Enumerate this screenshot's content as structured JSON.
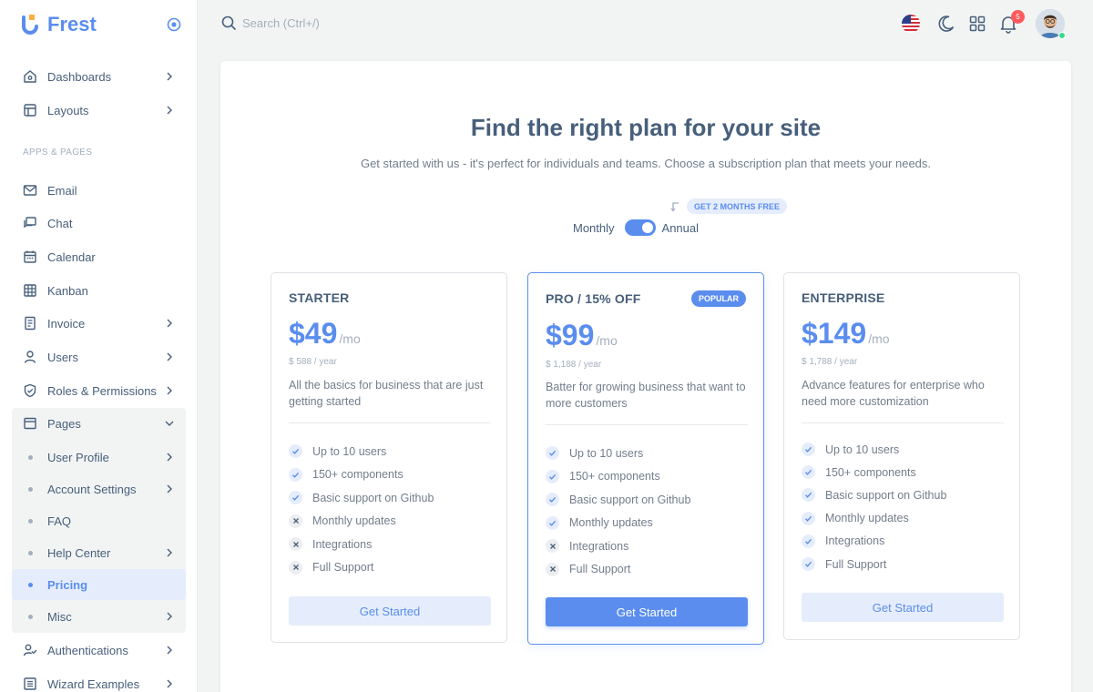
{
  "brand": {
    "name": "Frest",
    "color": "#5a8dee"
  },
  "sidebar": {
    "items_top": [
      {
        "label": "Dashboards",
        "icon": "home-icon",
        "has_children": true
      },
      {
        "label": "Layouts",
        "icon": "layout-icon",
        "has_children": true
      }
    ],
    "section_header": "APPS & PAGES",
    "items_apps": [
      {
        "label": "Email",
        "icon": "mail-icon",
        "has_children": false
      },
      {
        "label": "Chat",
        "icon": "chat-icon",
        "has_children": false
      },
      {
        "label": "Calendar",
        "icon": "calendar-icon",
        "has_children": false
      },
      {
        "label": "Kanban",
        "icon": "kanban-icon",
        "has_children": false
      },
      {
        "label": "Invoice",
        "icon": "invoice-icon",
        "has_children": true
      },
      {
        "label": "Users",
        "icon": "user-icon",
        "has_children": true
      },
      {
        "label": "Roles & Permissions",
        "icon": "shield-icon",
        "has_children": true
      },
      {
        "label": "Pages",
        "icon": "page-icon",
        "expanded": true
      }
    ],
    "pages_sub": [
      {
        "label": "User Profile",
        "has_children": true
      },
      {
        "label": "Account Settings",
        "has_children": true
      },
      {
        "label": "FAQ",
        "has_children": false
      },
      {
        "label": "Help Center",
        "has_children": true
      },
      {
        "label": "Pricing",
        "has_children": false,
        "active": true
      },
      {
        "label": "Misc",
        "has_children": true
      }
    ],
    "items_bottom": [
      {
        "label": "Authentications",
        "icon": "auth-icon",
        "has_children": true
      },
      {
        "label": "Wizard Examples",
        "icon": "wizard-icon",
        "has_children": true
      }
    ]
  },
  "topbar": {
    "search_placeholder": "Search (Ctrl+/)",
    "notification_count": "5"
  },
  "pricing": {
    "title": "Find the right plan for your site",
    "subtitle": "Get started with us - it's perfect for individuals and teams. Choose a subscription plan that meets your needs.",
    "promo": "GET 2 MONTHS FREE",
    "toggle_left": "Monthly",
    "toggle_right": "Annual",
    "billing": "Annual",
    "plans": [
      {
        "name": "STARTER",
        "price": "$49",
        "period": "/mo",
        "yearly": "$ 588 / year",
        "description": "All the basics for business that are just getting started",
        "features": [
          {
            "label": "Up to 10 users",
            "included": true
          },
          {
            "label": "150+ components",
            "included": true
          },
          {
            "label": "Basic support on Github",
            "included": true
          },
          {
            "label": "Monthly updates",
            "included": false
          },
          {
            "label": "Integrations",
            "included": false
          },
          {
            "label": "Full Support",
            "included": false
          }
        ],
        "button": "Get Started"
      },
      {
        "name": "PRO / 15% OFF",
        "badge": "POPULAR",
        "price": "$99",
        "period": "/mo",
        "yearly": "$ 1,188 / year",
        "description": "Batter for growing business that want to more customers",
        "features": [
          {
            "label": "Up to 10 users",
            "included": true
          },
          {
            "label": "150+ components",
            "included": true
          },
          {
            "label": "Basic support on Github",
            "included": true
          },
          {
            "label": "Monthly updates",
            "included": true
          },
          {
            "label": "Integrations",
            "included": false
          },
          {
            "label": "Full Support",
            "included": false
          }
        ],
        "button": "Get Started"
      },
      {
        "name": "ENTERPRISE",
        "price": "$149",
        "period": "/mo",
        "yearly": "$ 1,788 / year",
        "description": "Advance features for enterprise who need more customization",
        "features": [
          {
            "label": "Up to 10 users",
            "included": true
          },
          {
            "label": "150+ components",
            "included": true
          },
          {
            "label": "Basic support on Github",
            "included": true
          },
          {
            "label": "Monthly updates",
            "included": true
          },
          {
            "label": "Integrations",
            "included": true
          },
          {
            "label": "Full Support",
            "included": true
          }
        ],
        "button": "Get Started"
      }
    ]
  }
}
